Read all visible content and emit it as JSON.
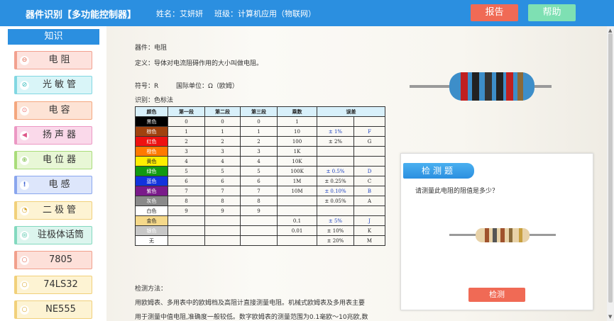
{
  "header": {
    "title": "器件识别【多功能控制器】",
    "student": "姓名：艾妍妍",
    "class": "班级：计算机应用（物联网）",
    "report_label": "报告",
    "help_label": "帮助"
  },
  "sidebar": {
    "heading": "知识",
    "items": [
      {
        "label": "电阻"
      },
      {
        "label": "光敏管"
      },
      {
        "label": "电容"
      },
      {
        "label": "扬声器"
      },
      {
        "label": "电位器"
      },
      {
        "label": "电感"
      },
      {
        "label": "二极管"
      },
      {
        "label": "驻极体话筒"
      },
      {
        "label": "7805"
      },
      {
        "label": "74LS32"
      },
      {
        "label": "NE555"
      }
    ]
  },
  "doc": {
    "device": "器件：电阻",
    "definition": "定义：导体对电流阻碍作用的大小叫做电阻。",
    "symbol": "符号：R",
    "unit": "国际单位：Ω（欧姆）",
    "identify": "识别：色标法",
    "table_headers": [
      "颜色",
      "第一段",
      "第二段",
      "第三段",
      "乘数",
      "误差"
    ],
    "rows": [
      {
        "color": "黑色",
        "c1": "0",
        "c2": "0",
        "c3": "0",
        "mult": "1",
        "tol": "",
        "tolcode": ""
      },
      {
        "color": "棕色",
        "c1": "1",
        "c2": "1",
        "c3": "1",
        "mult": "10",
        "tol": "± 1%",
        "tolcode": "F"
      },
      {
        "color": "红色",
        "c1": "2",
        "c2": "2",
        "c3": "2",
        "mult": "100",
        "tol": "± 2%",
        "tolcode": "G"
      },
      {
        "color": "橙色",
        "c1": "3",
        "c2": "3",
        "c3": "3",
        "mult": "1K",
        "tol": "",
        "tolcode": ""
      },
      {
        "color": "黄色",
        "c1": "4",
        "c2": "4",
        "c3": "4",
        "mult": "10K",
        "tol": "",
        "tolcode": ""
      },
      {
        "color": "绿色",
        "c1": "5",
        "c2": "5",
        "c3": "5",
        "mult": "100K",
        "tol": "± 0.5%",
        "tolcode": "D"
      },
      {
        "color": "蓝色",
        "c1": "6",
        "c2": "6",
        "c3": "6",
        "mult": "1M",
        "tol": "± 0.25%",
        "tolcode": "C"
      },
      {
        "color": "紫色",
        "c1": "7",
        "c2": "7",
        "c3": "7",
        "mult": "10M",
        "tol": "± 0.10%",
        "tolcode": "B"
      },
      {
        "color": "灰色",
        "c1": "8",
        "c2": "8",
        "c3": "8",
        "mult": "",
        "tol": "± 0.05%",
        "tolcode": "A"
      },
      {
        "color": "白色",
        "c1": "9",
        "c2": "9",
        "c3": "9",
        "mult": "",
        "tol": "",
        "tolcode": ""
      },
      {
        "color": "金色",
        "c1": "",
        "c2": "",
        "c3": "",
        "mult": "0.1",
        "tol": "± 5%",
        "tolcode": "J"
      },
      {
        "color": "银色",
        "c1": "",
        "c2": "",
        "c3": "",
        "mult": "0.01",
        "tol": "± 10%",
        "tolcode": "K"
      },
      {
        "color": "无",
        "c1": "",
        "c2": "",
        "c3": "",
        "mult": "",
        "tol": "± 20%",
        "tolcode": "M"
      }
    ],
    "method_title": "检测方法：",
    "method_line1": "用欧姆表、多用表中的欧姆档及高阻计直接测量电阻。机械式欧姆表及多用表主要",
    "method_line2": "用于测量中值电阻,准确度一般较低。数字欧姆表的测量范围为0.1毫欧～10兆欧,数"
  },
  "quiz": {
    "title": "检测题",
    "question": "请测量此电阻的阻值是多少？",
    "check_label": "检测"
  }
}
